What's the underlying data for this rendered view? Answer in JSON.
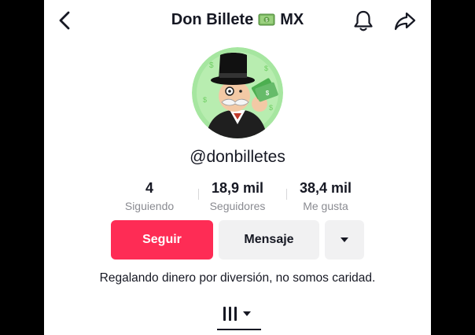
{
  "header": {
    "title_before": "Don Billete",
    "title_after": "MX",
    "title_emoji_icon": "money-bag-emoji-icon"
  },
  "profile": {
    "username": "@donbilletes",
    "avatar_icon": "monopoly-man-with-money-avatar"
  },
  "stats": [
    {
      "value": "4",
      "label": "Siguiendo"
    },
    {
      "value": "18,9 mil",
      "label": "Seguidores"
    },
    {
      "value": "38,4 mil",
      "label": "Me gusta"
    }
  ],
  "buttons": {
    "follow": "Seguir",
    "message": "Mensaje",
    "more_icon": "caret-down-icon"
  },
  "bio": "Regalando dinero por diversión, no somos caridad.",
  "tabs": {
    "videos_icon": "grid-videos-icon",
    "dropdown_icon": "caret-down-icon"
  },
  "colors": {
    "accent": "#fe2c55",
    "text": "#161823",
    "muted": "#8a8b91",
    "button_gray": "#f1f1f2",
    "avatar_bg": "#a6e6a0"
  }
}
